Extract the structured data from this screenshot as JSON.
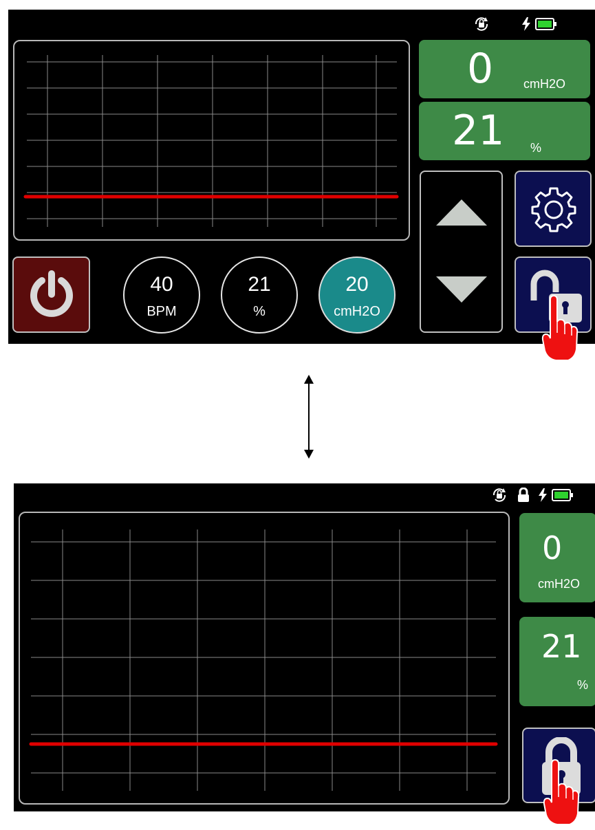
{
  "top_screen": {
    "pressure": {
      "value": "0",
      "unit": "cmH2O"
    },
    "oxygen": {
      "value": "21",
      "unit": "%"
    },
    "settings": [
      {
        "value": "40",
        "unit": "BPM",
        "active": false
      },
      {
        "value": "21",
        "unit": "%",
        "active": false
      },
      {
        "value": "20",
        "unit": "cmH2O",
        "active": true
      }
    ],
    "lock_state": "unlocked"
  },
  "bottom_screen": {
    "pressure": {
      "value": "0",
      "unit": "cmH2O"
    },
    "oxygen": {
      "value": "21",
      "unit": "%"
    },
    "lock_state": "locked"
  },
  "icons": [
    "rotation-lock-icon",
    "lock-icon",
    "charging-bolt-icon",
    "battery-icon",
    "power-icon",
    "gear-icon",
    "arrow-up-icon",
    "arrow-down-icon",
    "unlocked-padlock-icon",
    "locked-padlock-icon",
    "pointing-hand-icon"
  ],
  "colors": {
    "readout_green": "#3e8a47",
    "waveform_red": "#e00000",
    "active_knob": "#1a8a8a",
    "navy_button": "#0c0f50",
    "power_button": "#5a0c0c"
  }
}
